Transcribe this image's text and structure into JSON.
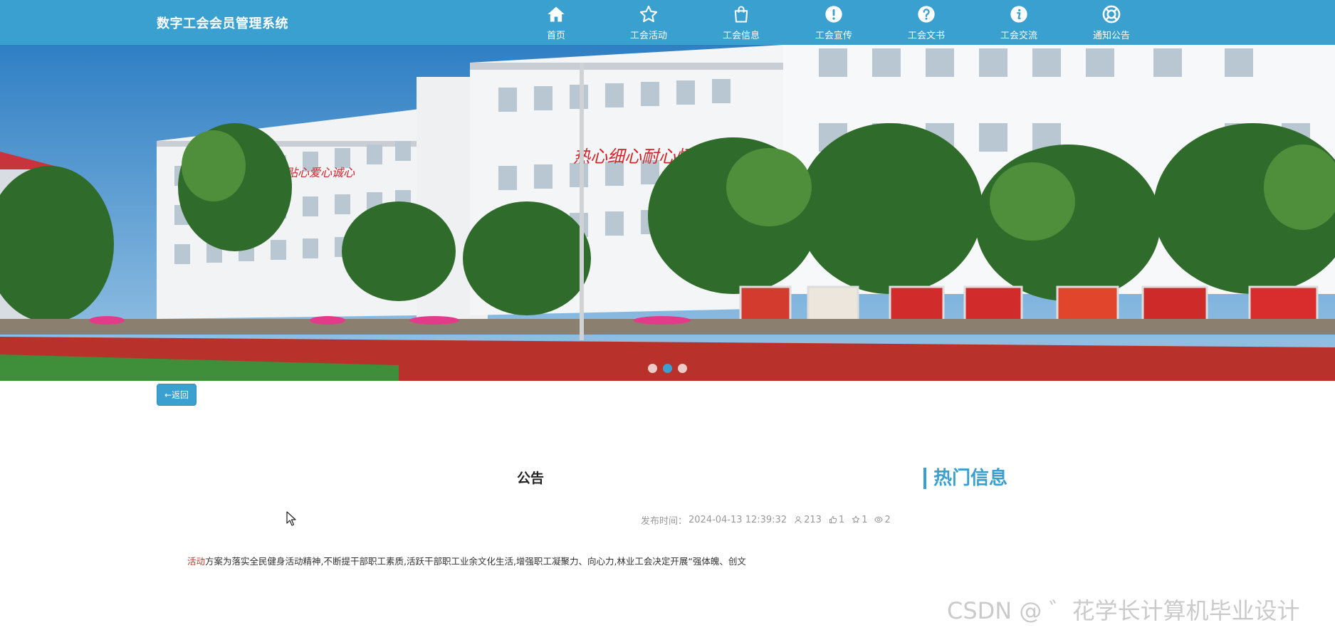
{
  "brand": "数字工会会员管理系统",
  "colors": {
    "primary": "#3aa0cf",
    "highlight": "#c0392b"
  },
  "nav": [
    {
      "label": "首页",
      "icon": "home-icon"
    },
    {
      "label": "工会活动",
      "icon": "star-icon"
    },
    {
      "label": "工会信息",
      "icon": "shopping-bag-icon"
    },
    {
      "label": "工会宣传",
      "icon": "exclamation-circle-icon"
    },
    {
      "label": "工会文书",
      "icon": "question-circle-icon"
    },
    {
      "label": "工会交流",
      "icon": "info-circle-icon"
    },
    {
      "label": "通知公告",
      "icon": "lifebuoy-icon"
    }
  ],
  "banner": {
    "slogan_right": "热心细心耐心恒心",
    "slogan_left": "关心贴心爱心诚心",
    "dots": 3,
    "active_dot": 1
  },
  "back_button": "←返回",
  "article": {
    "title": "公告",
    "publish_label": "发布时间：",
    "publish_time": "2024-04-13 12:39:32",
    "views": "213",
    "likes": "1",
    "favorites": "1",
    "comments": "2",
    "content_highlight": "活动",
    "content_rest": "方案为落实全民健身活动精神,不断提干部职工素质,活跃干部职工业余文化生活,增强职工凝聚力、向心力,林业工会决定开展“强体魄、创文"
  },
  "sidebar": {
    "title": "热门信息"
  },
  "watermark": "CSDN @ ゛花学长计算机毕业设计"
}
